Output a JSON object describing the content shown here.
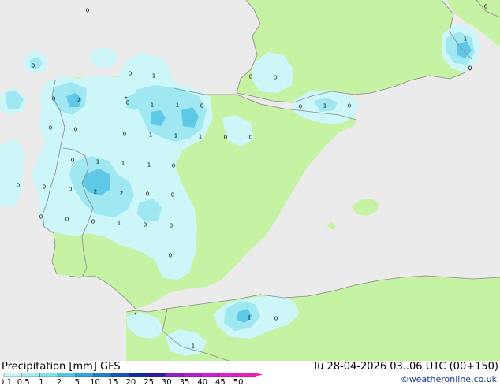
{
  "footer": {
    "title": "Precipitation [mm] GFS",
    "datetime": "Tu 28-04-2026 03..06 UTC (00+150)",
    "credit": "©weatheronline.co.uk"
  },
  "colorbar": {
    "ticks": [
      "0.1",
      "0.5",
      "1",
      "2",
      "5",
      "10",
      "15",
      "20",
      "25",
      "30",
      "35",
      "40",
      "45",
      "50"
    ],
    "colors": [
      "#c8f5f8",
      "#a6eef4",
      "#80e1ef",
      "#4fc7e6",
      "#2ba8dc",
      "#1f80cc",
      "#1557b8",
      "#0b2fa3",
      "#2e1aa6",
      "#8e1fc9",
      "#b21fd1",
      "#d11fd6",
      "#e61fc9",
      "#f21fb0"
    ]
  },
  "map_colors": {
    "sea": "#ebebeb",
    "land": "#c6f2a4",
    "precip_light": "#cdf6f8",
    "precip_medium": "#9fe8f2",
    "precip_heavy": "#5ec8e6",
    "border": "#888888"
  },
  "precip_labels": [
    {
      "id": "a1",
      "text": "0"
    },
    {
      "id": "a2",
      "text": "0"
    },
    {
      "id": "a3",
      "text": "0"
    },
    {
      "id": "a4",
      "text": "1"
    },
    {
      "id": "a5",
      "text": "0"
    },
    {
      "id": "a6",
      "text": "0"
    },
    {
      "id": "a7",
      "text": "2"
    },
    {
      "id": "a8",
      "text": "0"
    },
    {
      "id": "a9",
      "text": "1"
    },
    {
      "id": "a10",
      "text": "1"
    },
    {
      "id": "a11",
      "text": "0"
    },
    {
      "id": "a12",
      "text": "0"
    },
    {
      "id": "a13",
      "text": "1"
    },
    {
      "id": "a14",
      "text": "0"
    },
    {
      "id": "a15",
      "text": "0"
    },
    {
      "id": "a16",
      "text": "0"
    },
    {
      "id": "a17",
      "text": "1"
    },
    {
      "id": "a18",
      "text": "1"
    },
    {
      "id": "a19",
      "text": "1"
    },
    {
      "id": "a20",
      "text": "0"
    },
    {
      "id": "a21",
      "text": "0"
    },
    {
      "id": "a22",
      "text": "0"
    },
    {
      "id": "a23",
      "text": "1"
    },
    {
      "id": "a24",
      "text": "1"
    },
    {
      "id": "a25",
      "text": "1"
    },
    {
      "id": "a26",
      "text": "0"
    },
    {
      "id": "a27",
      "text": "0"
    },
    {
      "id": "a28",
      "text": "0"
    },
    {
      "id": "a29",
      "text": "2"
    },
    {
      "id": "a30",
      "text": "2"
    },
    {
      "id": "a31",
      "text": "0"
    },
    {
      "id": "a32",
      "text": "0"
    },
    {
      "id": "a33",
      "text": "0"
    },
    {
      "id": "a34",
      "text": "0"
    },
    {
      "id": "a35",
      "text": "0"
    },
    {
      "id": "a36",
      "text": "1"
    },
    {
      "id": "a37",
      "text": "0"
    },
    {
      "id": "a38",
      "text": "0"
    },
    {
      "id": "a39",
      "text": "0"
    },
    {
      "id": "a40",
      "text": "0"
    },
    {
      "id": "a41",
      "text": "1"
    },
    {
      "id": "a42",
      "text": "0"
    },
    {
      "id": "a43",
      "text": "1"
    },
    {
      "id": "a44",
      "text": "0"
    },
    {
      "id": "a45",
      "text": "0"
    },
    {
      "id": "a46",
      "text": "1"
    },
    {
      "id": "a47",
      "text": "0"
    },
    {
      "id": "a48",
      "text": "0"
    }
  ]
}
